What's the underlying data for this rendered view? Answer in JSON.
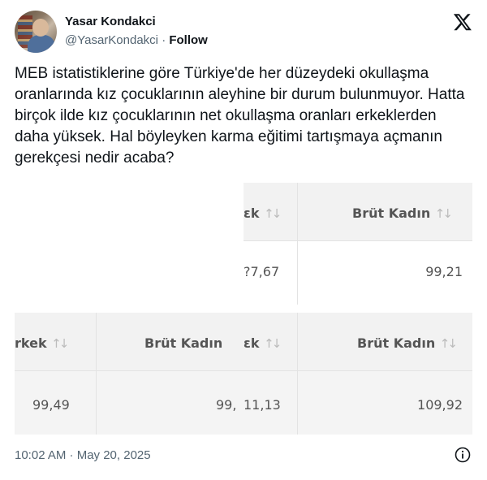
{
  "author": {
    "name": "Yasar Kondakci",
    "handle": "@YasarKondakci",
    "separator": "·",
    "follow_label": "Follow"
  },
  "tweet": {
    "text": "MEB istatistiklerine göre Türkiye'de her düzeydeki okullaşma oranlarında kız çocuklarının aleyhine bir durum bulunmuyor. Hatta birçok ilde kız çocuklarının net okullaşma oranları erkeklerden daha yüksek. Hal böyleyken karma eğitimi tartışmaya açmanın gerekçesi nedir acaba?"
  },
  "media": {
    "tile_top_right": {
      "header_left": "ɛk",
      "header_right": "Brüt Kadın",
      "value_left": "?7,67",
      "value_right": "99,21"
    },
    "tile_bottom_left": {
      "header_left": "rkek",
      "header_right": "Brüt Kadın",
      "value_left": "99,49",
      "value_right": "99,"
    },
    "tile_bottom_right": {
      "header_left": "ɛk",
      "header_right": "Brüt Kadın",
      "value_left": "11,13",
      "value_right": "109,92"
    },
    "sort_arrows": "↑↓"
  },
  "footer": {
    "timestamp": "10:02 AM · May 20, 2025"
  },
  "icons": {
    "logo": "x-logo-icon",
    "info": "info-icon"
  },
  "colors": {
    "text": "#0f1419",
    "muted": "#536471"
  }
}
